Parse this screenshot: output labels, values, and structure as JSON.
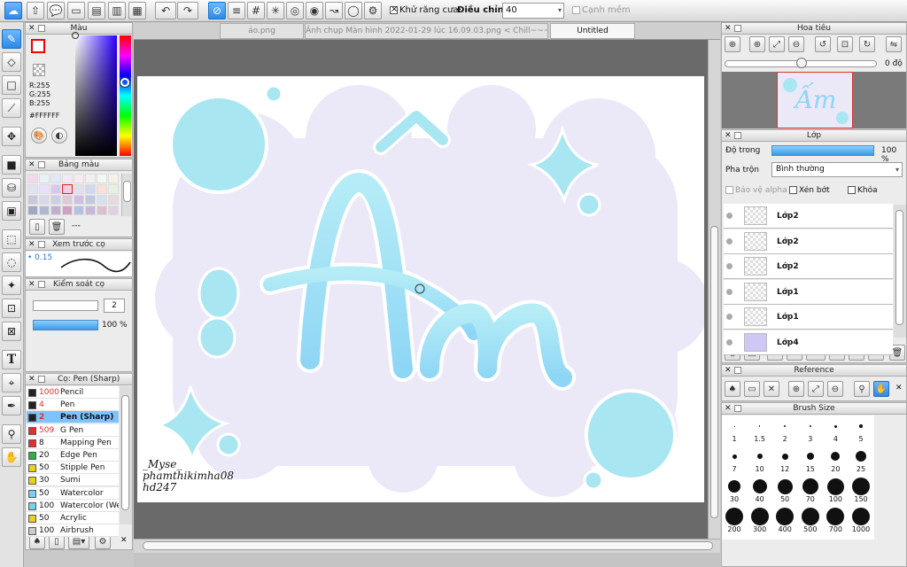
{
  "toolbar": {
    "antialias_label": "Khử răng cưa",
    "adjust_label": "Điều chỉnh",
    "adjust_value": "40",
    "soft_edge_label": "Cạnh mềm"
  },
  "tabs": [
    {
      "label": "ảo.png"
    },
    {
      "label": "Ảnh chụp Màn hình 2022-01-29 lúc 16.09.03.png < Chill~~~ >"
    },
    {
      "label": "Untitled"
    }
  ],
  "color_panel": {
    "title": "Màu",
    "r": "R:255",
    "g": "G:255",
    "b": "B:255",
    "hex": "#FFFFFF"
  },
  "palette_panel": {
    "title": "Bảng màu",
    "name": "---"
  },
  "brush_preview": {
    "title": "Xem trước cọ",
    "size": "0.15"
  },
  "brush_control": {
    "title": "Kiểm soát cọ",
    "size_value": "2",
    "opacity_value": "100 %"
  },
  "brush_list": {
    "title": "Cọ: Pen (Sharp)",
    "items": [
      {
        "size": "1000",
        "name": "Pencil",
        "color": "#222222",
        "size_color": "#e03030"
      },
      {
        "size": "4",
        "name": "Pen",
        "color": "#222222",
        "size_color": "#e03030"
      },
      {
        "size": "2",
        "name": "Pen (Sharp)",
        "color": "#222222",
        "size_color": "#e03030",
        "selected": true
      },
      {
        "size": "509",
        "name": "G Pen",
        "color": "#e03030",
        "size_color": "#e03030"
      },
      {
        "size": "8",
        "name": "Mapping Pen",
        "color": "#e03030",
        "size_color": "#111111"
      },
      {
        "size": "20",
        "name": "Edge Pen",
        "color": "#2ab04a",
        "size_color": "#111111"
      },
      {
        "size": "50",
        "name": "Stipple Pen",
        "color": "#e8d020",
        "size_color": "#111111"
      },
      {
        "size": "30",
        "name": "Sumi",
        "color": "#e8d020",
        "size_color": "#111111"
      },
      {
        "size": "50",
        "name": "Watercolor",
        "color": "#7ad0f0",
        "size_color": "#111111"
      },
      {
        "size": "100",
        "name": "Watercolor (Wet)",
        "color": "#7ad0f0",
        "size_color": "#111111"
      },
      {
        "size": "50",
        "name": "Acrylic",
        "color": "#e8d020",
        "size_color": "#111111"
      },
      {
        "size": "100",
        "name": "Airbrush",
        "color": "#cccccc",
        "size_color": "#111111"
      }
    ]
  },
  "artwork": {
    "title_text": "Ấm",
    "signature": [
      "_Myse_",
      "phamthikimha08",
      "hd247"
    ]
  },
  "navigator": {
    "title": "Hoa tiêu",
    "angle": "0 độ",
    "thumb_text": "Ấm"
  },
  "layer_panel": {
    "title": "Lớp",
    "opacity_label": "Độ trong",
    "opacity_value": "100 %",
    "blend_label": "Pha trộn",
    "blend_value": "Bình thường",
    "protect_alpha": "Bảo vệ alpha",
    "clipping": "Xén bớt",
    "lock": "Khóa",
    "layers": [
      {
        "name": "Lớp2"
      },
      {
        "name": "Lớp2"
      },
      {
        "name": "Lớp2"
      },
      {
        "name": "Lớp1"
      },
      {
        "name": "Lớp1"
      },
      {
        "name": "Lớp4"
      }
    ]
  },
  "reference_panel": {
    "title": "Reference"
  },
  "brush_size_panel": {
    "title": "Brush Size",
    "sizes": [
      "1",
      "1.5",
      "2",
      "3",
      "4",
      "5",
      "7",
      "10",
      "12",
      "15",
      "20",
      "25",
      "30",
      "40",
      "50",
      "70",
      "100",
      "150",
      "200",
      "300",
      "400",
      "500",
      "700",
      "1000"
    ]
  },
  "colors": {
    "accent": "#2a8ae6",
    "canvas_bg": "#ffffff",
    "cloud": "#ebe8f8",
    "art_blue": "#a8e6f2"
  }
}
